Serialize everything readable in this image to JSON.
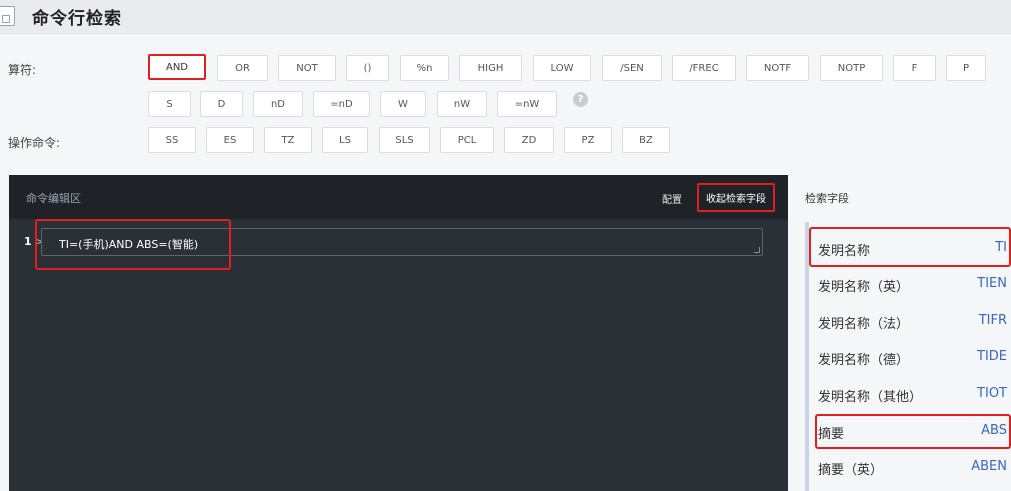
{
  "header": {
    "title": "命令行检索"
  },
  "operators": {
    "label": "算符:",
    "row1": [
      "AND",
      "OR",
      "NOT",
      "()",
      "%n",
      "HIGH",
      "LOW",
      "/SEN",
      "/FREC",
      "NOTF",
      "NOTP",
      "F",
      "P"
    ],
    "row2": [
      "S",
      "D",
      "nD",
      "=nD",
      "W",
      "nW",
      "=nW"
    ],
    "help": "?"
  },
  "commands": {
    "label": "操作命令:",
    "items": [
      "SS",
      "ES",
      "TZ",
      "LS",
      "SLS",
      "PCL",
      "ZD",
      "PZ",
      "BZ"
    ]
  },
  "editor": {
    "title": "命令编辑区",
    "config_label": "配置",
    "collapse_label": "收起检索字段",
    "line_number": "1",
    "command_text": "TI=(手机)AND ABS=(智能)"
  },
  "fields": {
    "title": "检索字段",
    "items": [
      {
        "name": "发明名称",
        "code": "TI"
      },
      {
        "name": "发明名称（英）",
        "code": "TIEN"
      },
      {
        "name": "发明名称（法）",
        "code": "TIFR"
      },
      {
        "name": "发明名称（德）",
        "code": "TIDE"
      },
      {
        "name": "发明名称（其他）",
        "code": "TIOT"
      },
      {
        "name": "摘要",
        "code": "ABS"
      },
      {
        "name": "摘要（英）",
        "code": "ABEN"
      }
    ]
  },
  "colors": {
    "highlight": "#e02020",
    "editor_bg": "#2b3036",
    "field_code": "#3a66c8"
  }
}
